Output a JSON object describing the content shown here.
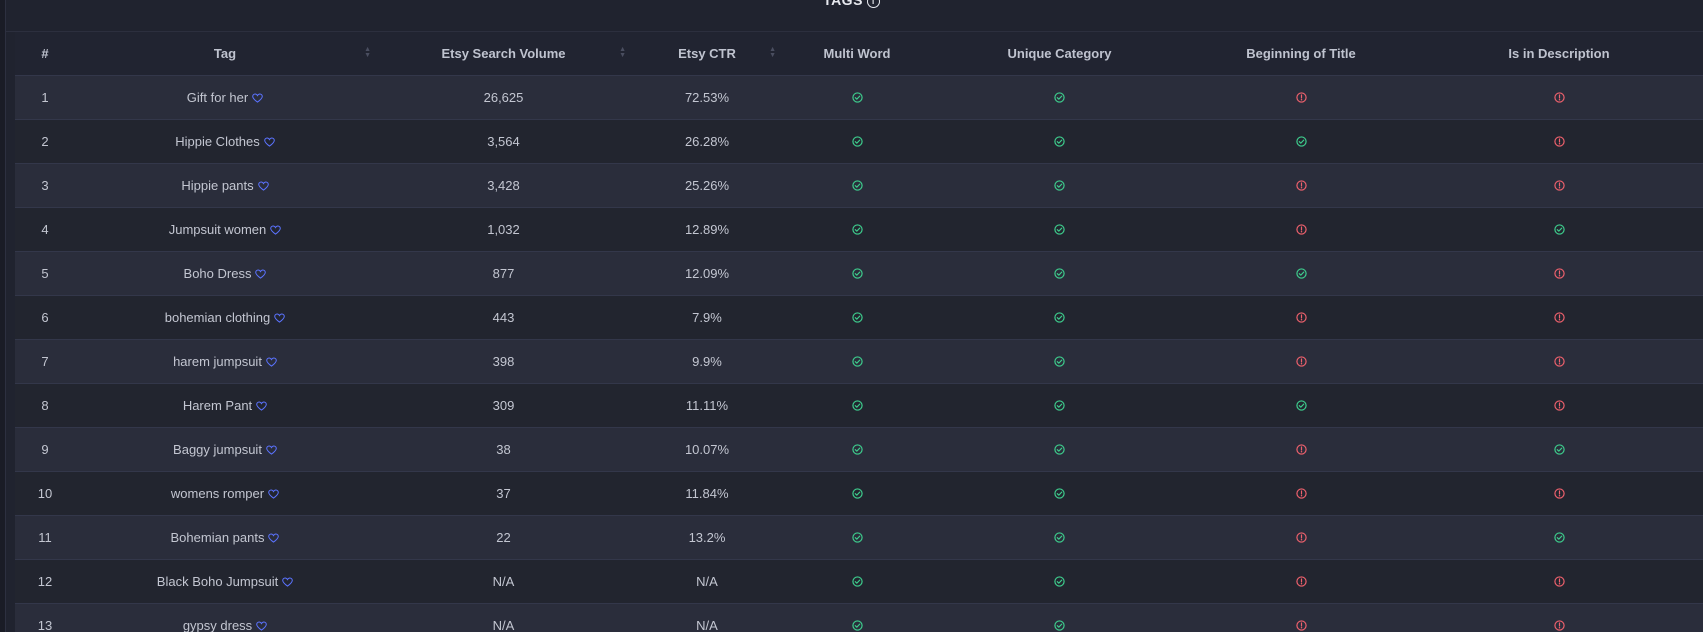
{
  "section": {
    "title": "TAGS",
    "info_icon": "info-icon"
  },
  "colors": {
    "check": "#3ecf8e",
    "alert": "#f0616d",
    "heart": "#5b73ff"
  },
  "columns": {
    "num": "#",
    "tag": "Tag",
    "volume": "Etsy Search Volume",
    "ctr": "Etsy CTR",
    "multi": "Multi Word",
    "unique": "Unique Category",
    "beginning": "Beginning of Title",
    "description": "Is in Description"
  },
  "rows": [
    {
      "num": "1",
      "tag": "Gift for her",
      "volume": "26,625",
      "ctr": "72.53%",
      "multi": "check",
      "unique": "check",
      "beginning": "alert",
      "description": "alert"
    },
    {
      "num": "2",
      "tag": "Hippie Clothes",
      "volume": "3,564",
      "ctr": "26.28%",
      "multi": "check",
      "unique": "check",
      "beginning": "check",
      "description": "alert"
    },
    {
      "num": "3",
      "tag": "Hippie pants",
      "volume": "3,428",
      "ctr": "25.26%",
      "multi": "check",
      "unique": "check",
      "beginning": "alert",
      "description": "alert"
    },
    {
      "num": "4",
      "tag": "Jumpsuit women",
      "volume": "1,032",
      "ctr": "12.89%",
      "multi": "check",
      "unique": "check",
      "beginning": "alert",
      "description": "check"
    },
    {
      "num": "5",
      "tag": "Boho Dress",
      "volume": "877",
      "ctr": "12.09%",
      "multi": "check",
      "unique": "check",
      "beginning": "check",
      "description": "alert"
    },
    {
      "num": "6",
      "tag": "bohemian clothing",
      "volume": "443",
      "ctr": "7.9%",
      "multi": "check",
      "unique": "check",
      "beginning": "alert",
      "description": "alert"
    },
    {
      "num": "7",
      "tag": "harem jumpsuit",
      "volume": "398",
      "ctr": "9.9%",
      "multi": "check",
      "unique": "check",
      "beginning": "alert",
      "description": "alert"
    },
    {
      "num": "8",
      "tag": "Harem Pant",
      "volume": "309",
      "ctr": "11.11%",
      "multi": "check",
      "unique": "check",
      "beginning": "check",
      "description": "alert"
    },
    {
      "num": "9",
      "tag": "Baggy jumpsuit",
      "volume": "38",
      "ctr": "10.07%",
      "multi": "check",
      "unique": "check",
      "beginning": "alert",
      "description": "check"
    },
    {
      "num": "10",
      "tag": "womens romper",
      "volume": "37",
      "ctr": "11.84%",
      "multi": "check",
      "unique": "check",
      "beginning": "alert",
      "description": "alert"
    },
    {
      "num": "11",
      "tag": "Bohemian pants",
      "volume": "22",
      "ctr": "13.2%",
      "multi": "check",
      "unique": "check",
      "beginning": "alert",
      "description": "check"
    },
    {
      "num": "12",
      "tag": "Black Boho Jumpsuit",
      "volume": "N/A",
      "ctr": "N/A",
      "multi": "check",
      "unique": "check",
      "beginning": "alert",
      "description": "alert"
    },
    {
      "num": "13",
      "tag": "gypsy dress",
      "volume": "N/A",
      "ctr": "N/A",
      "multi": "check",
      "unique": "check",
      "beginning": "alert",
      "description": "alert"
    }
  ]
}
